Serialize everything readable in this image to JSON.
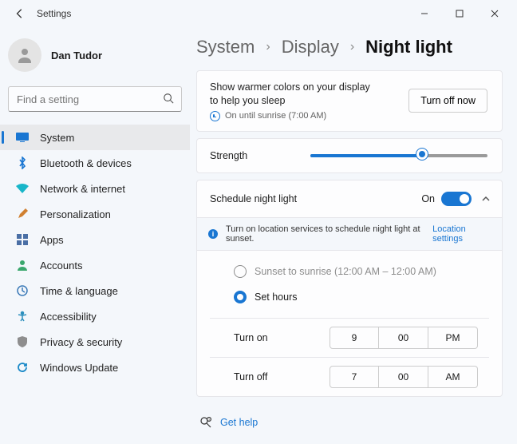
{
  "window": {
    "title": "Settings"
  },
  "user": {
    "name": "Dan Tudor"
  },
  "search": {
    "placeholder": "Find a setting"
  },
  "nav": {
    "items": [
      {
        "label": "System",
        "icon": "system"
      },
      {
        "label": "Bluetooth & devices",
        "icon": "bluetooth"
      },
      {
        "label": "Network & internet",
        "icon": "wifi"
      },
      {
        "label": "Personalization",
        "icon": "brush"
      },
      {
        "label": "Apps",
        "icon": "apps"
      },
      {
        "label": "Accounts",
        "icon": "accounts"
      },
      {
        "label": "Time & language",
        "icon": "clock"
      },
      {
        "label": "Accessibility",
        "icon": "access"
      },
      {
        "label": "Privacy & security",
        "icon": "shield"
      },
      {
        "label": "Windows Update",
        "icon": "update"
      }
    ]
  },
  "breadcrumb": {
    "a": "System",
    "b": "Display",
    "c": "Night light"
  },
  "description": {
    "text": "Show warmer colors on your display to help you sleep",
    "status": "On until sunrise (7:00 AM)",
    "button": "Turn off now"
  },
  "strength": {
    "label": "Strength",
    "value_pct": 63
  },
  "schedule": {
    "title": "Schedule night light",
    "state": "On",
    "notice": "Turn on location services to schedule night light at sunset.",
    "notice_link": "Location settings",
    "radio_sunset": "Sunset to sunrise (12:00 AM – 12:00 AM)",
    "radio_hours": "Set hours",
    "on_label": "Turn on",
    "off_label": "Turn off",
    "on": {
      "h": "9",
      "m": "00",
      "ap": "PM"
    },
    "off": {
      "h": "7",
      "m": "00",
      "ap": "AM"
    }
  },
  "help": {
    "label": "Get help"
  }
}
